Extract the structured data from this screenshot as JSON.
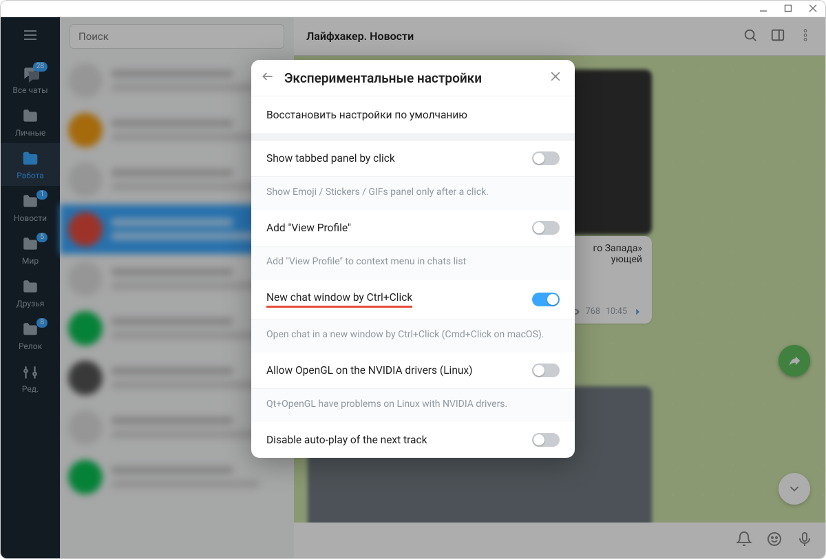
{
  "titlebar": {},
  "nav": {
    "items": [
      {
        "label": "Все чаты",
        "badge": "28"
      },
      {
        "label": "Личные",
        "badge": ""
      },
      {
        "label": "Работа",
        "badge": ""
      },
      {
        "label": "Новости",
        "badge": "1"
      },
      {
        "label": "Мир",
        "badge": "5"
      },
      {
        "label": "Друзья",
        "badge": ""
      },
      {
        "label": "Релок",
        "badge": "8"
      },
      {
        "label": "Ред.",
        "badge": ""
      }
    ]
  },
  "chatcol": {
    "search_placeholder": "Поиск"
  },
  "header": {
    "title": "Лайфхакер. Новости"
  },
  "msg": {
    "snippet1": "го Запада»",
    "snippet2": "ующей",
    "views": "768",
    "time": "10:45"
  },
  "modal": {
    "title": "Экспериментальные настройки",
    "restore": "Восстановить настройки по умолчанию",
    "s1": {
      "title": "Show tabbed panel by click",
      "desc": "Show Emoji / Stickers / GIFs panel only after a click."
    },
    "s2": {
      "title": "Add \"View Profile\"",
      "desc": "Add \"View Profile\" to context menu in chats list"
    },
    "s3": {
      "title": "New chat window by Ctrl+Click",
      "desc": "Open chat in a new window by Ctrl+Click (Cmd+Click on macOS)."
    },
    "s4": {
      "title": "Allow OpenGL on the NVIDIA drivers (Linux)",
      "desc": "Qt+OpenGL have problems on Linux with NVIDIA drivers."
    },
    "s5": {
      "title": "Disable auto-play of the next track"
    }
  }
}
